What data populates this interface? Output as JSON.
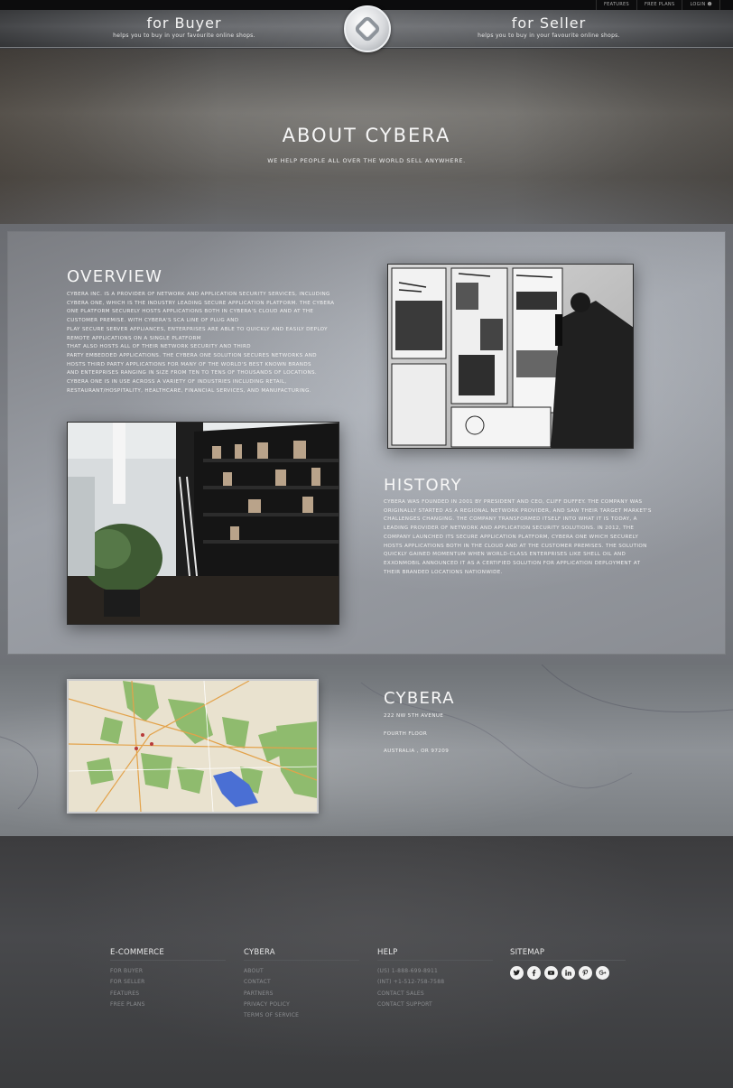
{
  "utility_nav": {
    "features": "FEATURES",
    "free_plans": "FREE PLANS",
    "login": "LOGIN"
  },
  "header": {
    "buyer_title": "for Buyer",
    "buyer_sub": "helps you to buy in your favourite online shops.",
    "seller_title": "for Seller",
    "seller_sub": "helps you to buy in your favourite online shops."
  },
  "hero": {
    "title": "ABOUT CYBERA",
    "subtitle": "WE HELP PEOPLE ALL OVER THE WORLD SELL ANYWHERE."
  },
  "overview": {
    "title": "OVERVIEW",
    "lines": [
      "CYBERA INC. IS A PROVIDER OF NETWORK AND APPLICATION SECURITY SERVICES, INCLUDING",
      "CYBERA ONE, WHICH IS THE INDUSTRY LEADING SECURE APPLICATION PLATFORM. THE CYBERA",
      "ONE PLATFORM SECURELY HOSTS APPLICATIONS BOTH IN CYBERA'S CLOUD AND AT THE",
      "CUSTOMER PREMISE. WITH CYBERA'S SCA LINE OF PLUG AND",
      "PLAY SECURE SERVER APPLIANCES, ENTERPRISES ARE ABLE TO QUICKLY AND EASILY DEPLOY",
      "REMOTE APPLICATIONS ON A SINGLE PLATFORM",
      "THAT ALSO HOSTS ALL OF THEIR NETWORK SECURITY AND THIRD",
      "PARTY EMBEDDED APPLICATIONS. THE CYBERA ONE SOLUTION SECURES NETWORKS AND",
      "HOSTS THIRD PARTY APPLICATIONS FOR MANY OF THE WORLD'S BEST KNOWN BRANDS",
      "AND ENTERPRISES RANGING IN SIZE FROM TEN TO TENS OF THOUSANDS OF LOCATIONS.",
      "CYBERA ONE IS IN USE ACROSS A VARIETY OF INDUSTRIES INCLUDING RETAIL,",
      "RESTAURANT/HOSPITALITY, HEALTHCARE, FINANCIAL SERVICES, AND MANUFACTURING."
    ]
  },
  "history": {
    "title": "HISTORY",
    "lines": [
      "CYBERA WAS FOUNDED IN 2001 BY PRESIDENT AND CEO, CLIFF DUFFEY. THE COMPANY WAS",
      "ORIGINALLY STARTED AS A REGIONAL NETWORK PROVIDER, AND SAW THEIR TARGET MARKET'S",
      "CHALLENGES CHANGING. THE COMPANY TRANSFORMED ITSELF INTO WHAT IT IS TODAY, A",
      "LEADING PROVIDER OF NETWORK AND APPLICATION SECURITY SOLUTIONS. IN 2012, THE",
      "COMPANY LAUNCHED ITS SECURE APPLICATION PLATFORM, CYBERA ONE WHICH SECURELY",
      "HOSTS APPLICATIONS BOTH IN THE CLOUD AND AT THE CUSTOMER PREMISES. THE SOLUTION",
      "QUICKLY GAINED MOMENTUM WHEN WORLD-CLASS ENTERPRISES LIKE SHELL OIL AND",
      "EXXONMOBIL ANNOUNCED IT AS A CERTIFIED SOLUTION FOR APPLICATION DEPLOYMENT AT",
      "THEIR BRANDED LOCATIONS NATIONWIDE."
    ]
  },
  "contact": {
    "title": "CYBERA",
    "address1": "222 NW 5TH AVENUE",
    "address2": "FOURTH FLOOR",
    "address3": "AUSTRALIA , OR 97209"
  },
  "footer": {
    "ecommerce": {
      "heading": "E-COMMERCE",
      "links": [
        "FOR BUYER",
        "FOR SELLER",
        "FEATURES",
        "FREE PLANS"
      ]
    },
    "cybera": {
      "heading": "CYBERA",
      "links": [
        "ABOUT",
        "CONTACT",
        "PARTNERS",
        "PRIVACY POLICY",
        "TERMS OF SERVICE"
      ]
    },
    "help": {
      "heading": "HELP",
      "links": [
        "(US) 1-888-699-8911",
        "(INT) +1-512-758-7588",
        "CONTACT SALES",
        "CONTACT SUPPORT"
      ]
    },
    "sitemap": {
      "heading": "SITEMAP",
      "socials": [
        "twitter-icon",
        "facebook-icon",
        "youtube-icon",
        "linkedin-icon",
        "pinterest-icon",
        "google-plus-icon"
      ]
    }
  }
}
